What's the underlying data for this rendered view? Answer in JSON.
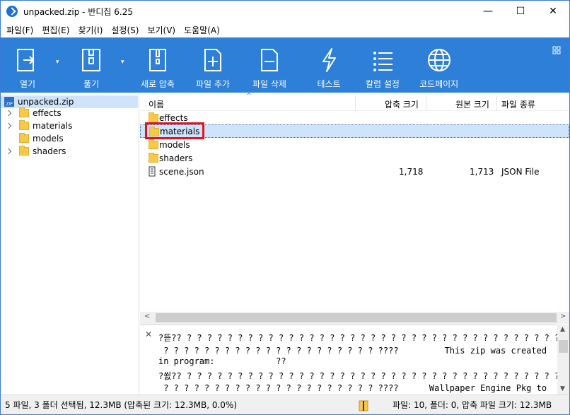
{
  "window": {
    "title": "unpacked.zip - 반디집 6.25",
    "minimize": "—",
    "maximize": "☐",
    "close": "✕"
  },
  "menu": [
    "파일(F)",
    "편집(E)",
    "찾기(I)",
    "설정(S)",
    "보기(V)",
    "도움말(A)"
  ],
  "toolbar": {
    "open": "열기",
    "extract": "풀기",
    "new_archive": "새로 압축",
    "add_file": "파일 추가",
    "delete_file": "파일 삭제",
    "test": "테스트",
    "column_settings": "칼럼 설정",
    "codepage": "코드페이지"
  },
  "tree": {
    "root": "unpacked.zip",
    "items": [
      "effects",
      "materials",
      "models",
      "shaders"
    ]
  },
  "list": {
    "columns": {
      "name": "이름",
      "compressed": "압축 크기",
      "original": "원본 크기",
      "type": "파일 종류"
    },
    "rows": [
      {
        "name": "effects",
        "compressed": "",
        "original": "",
        "type": ""
      },
      {
        "name": "materials",
        "compressed": "",
        "original": "",
        "type": ""
      },
      {
        "name": "models",
        "compressed": "",
        "original": "",
        "type": ""
      },
      {
        "name": "shaders",
        "compressed": "",
        "original": "",
        "type": ""
      },
      {
        "name": "scene.json",
        "compressed": "1,718",
        "original": "1,713",
        "type": "JSON File"
      }
    ]
  },
  "preview": {
    "lines": [
      "?뜯?? ? ? ? ? ? ? ? ? ? ? ? ? ? ? ? ? ? ? ? ? ? ? ? ? ? ? ? ? ? ? ? ? ? ? ? ? ? ? ?",
      " ? ? ? ? ? ? ? ? ? ? ? ? ? ? ? ? ? ? ? ? ? ????         This zip was created",
      "in program:            ??",
      "?쐸?? ? ? ? ? ? ? ? ? ? ? ? ? ? ? ? ? ? ? ? ? ? ? ? ? ? ? ? ? ? ? ? ? ? ? ? ? ? ? ?",
      " ? ? ? ? ? ? ? ? ? ? ? ? ? ? ? ? ? ? ? ? ? ????      Wallpaper Engine Pkg to"
    ]
  },
  "status": {
    "left": "5 파일, 3 폴더 선택됨, 12.3MB (압축된 크기: 12.3MB, 0.0%)",
    "right": "파일: 10, 폴더: 0, 압축 파일 크기: 12.3MB"
  },
  "colors": {
    "toolbar_bg": "#2d7fd8",
    "selection_outline": "#e0141e",
    "selected_row_bg": "#cfe3fa"
  }
}
